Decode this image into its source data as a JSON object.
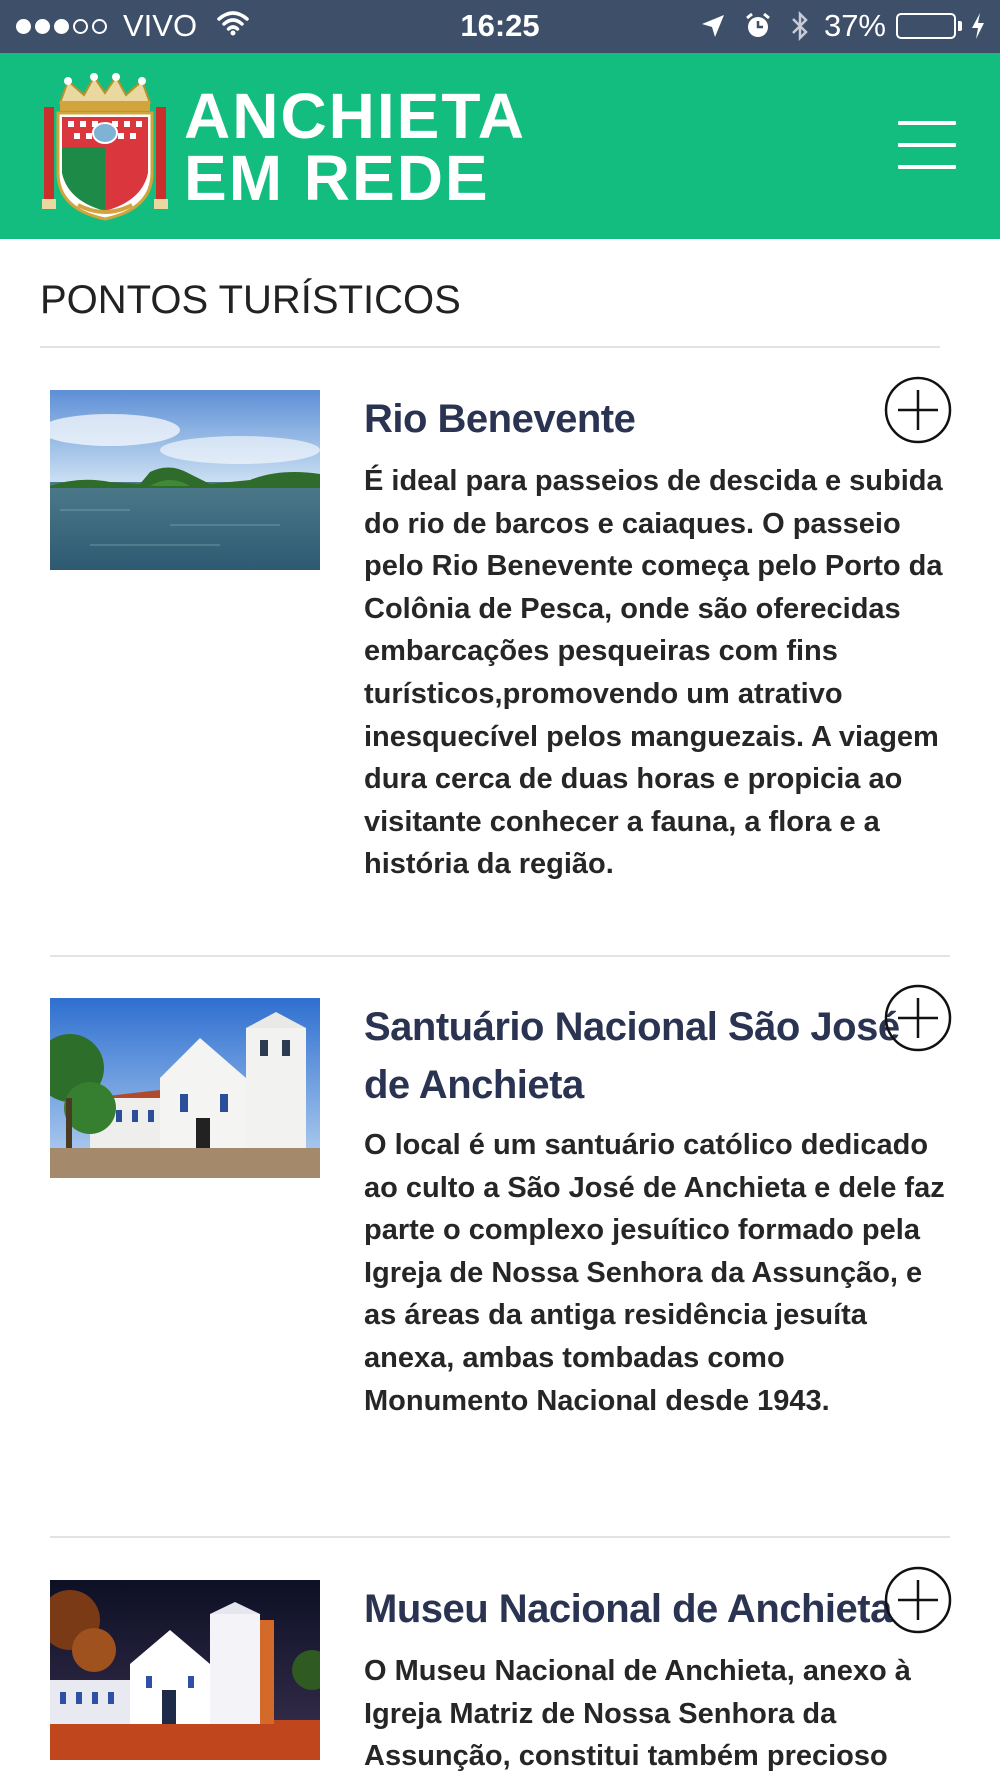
{
  "status_bar": {
    "carrier": "VIVO",
    "time": "16:25",
    "battery_percent": "37%",
    "battery_level": 0.37,
    "battery_color": "#4cd964"
  },
  "header": {
    "brand_line1": "ANCHIETA",
    "brand_line2": "EM REDE",
    "logo_icon": "municipal-crest",
    "menu_icon": "hamburger-menu-icon",
    "background": "#13bd7f"
  },
  "section": {
    "title": "PONTOS TURÍSTICOS"
  },
  "items": [
    {
      "title": "Rio Benevente",
      "description": "É ideal para passeios de descida e subida do rio de barcos e caiaques. O passeio pelo Rio Benevente começa pelo Porto da Colônia de Pesca, onde são oferecidas embarcações pesqueiras com fins turísticos,promovendo um atrativo inesquecível pelos manguezais. A viagem dura cerca de duas horas e propicia ao visitante conhecer a fauna, a flora e a história da região.",
      "image": "river-photo"
    },
    {
      "title": "Santuário Nacional São José de Anchieta",
      "description": "O local é um santuário católico dedicado ao culto a São José de Anchieta e dele faz parte o complexo jesuítico formado pela Igreja de Nossa Senhora da Assunção, e as áreas da antiga residência jesuíta anexa, ambas tombadas como Monumento Nacional desde 1943.",
      "image": "church-day-photo"
    },
    {
      "title": "Museu Nacional de Anchieta",
      "description": "O Museu Nacional de Anchieta, anexo à Igreja Matriz de Nossa Senhora da Assunção, constitui também precioso",
      "image": "church-night-photo"
    }
  ]
}
